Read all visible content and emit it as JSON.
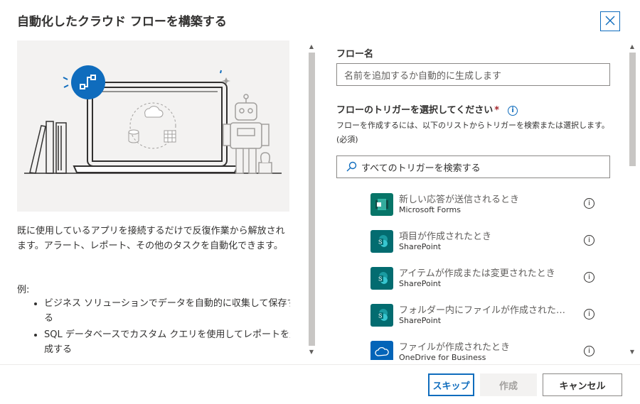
{
  "dialog": {
    "title": "自動化したクラウド フローを構築する"
  },
  "left_pane": {
    "description": "既に使用しているアプリを接続するだけで反復作業から解放されます。アラート、レポート、その他のタスクを自動化できます。",
    "examples_label": "例:",
    "examples": [
      "ビジネス ソリューションでデータを自動的に収集して保存する",
      "SQL データベースでカスタム クエリを使用してレポートを生成する"
    ]
  },
  "right_pane": {
    "flow_name_label": "フロー名",
    "flow_name_placeholder": "名前を追加するか自動的に生成します",
    "trigger_label": "フローのトリガーを選択してください",
    "required_mark": "*",
    "trigger_help": "フローを作成するには、以下のリストからトリガーを検索または選択します。(必須)",
    "search_placeholder": "すべてのトリガーを検索する",
    "triggers": [
      {
        "name": "新しい応答が送信されるとき",
        "source": "Microsoft Forms",
        "color": "#077568",
        "icon": "forms-icon"
      },
      {
        "name": "項目が作成されたとき",
        "source": "SharePoint",
        "color": "#036c70",
        "icon": "sharepoint-icon"
      },
      {
        "name": "アイテムが作成または変更されたとき",
        "source": "SharePoint",
        "color": "#036c70",
        "icon": "sharepoint-icon"
      },
      {
        "name": "フォルダー内にファイルが作成されたとき",
        "source": "SharePoint",
        "color": "#036c70",
        "icon": "sharepoint-icon"
      },
      {
        "name": "ファイルが作成されたとき",
        "source": "OneDrive for Business",
        "color": "#0364b8",
        "icon": "onedrive-icon"
      }
    ]
  },
  "footer": {
    "skip_label": "スキップ",
    "create_label": "作成",
    "cancel_label": "キャンセル"
  },
  "colors": {
    "accent": "#0f6cbd",
    "required": "#a4262c"
  }
}
